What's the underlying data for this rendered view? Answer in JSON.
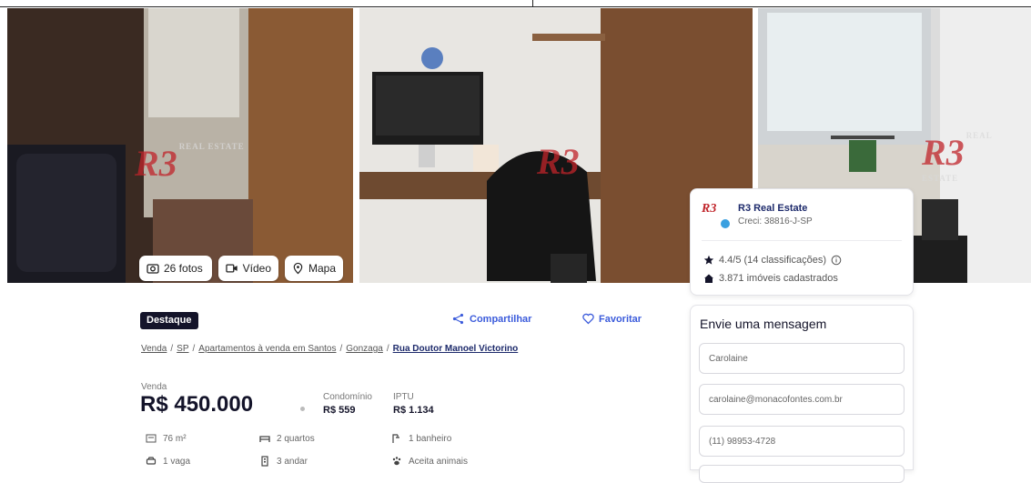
{
  "gallery": {
    "photos_label": "26 fotos",
    "video_label": "Vídeo",
    "map_label": "Mapa",
    "watermark": "R3",
    "watermark_sub": "REAL ESTATE"
  },
  "agent": {
    "name": "R3 Real Estate",
    "creci": "Creci: 38816-J-SP",
    "rating": "4.4/5 (14 classificações)",
    "listings": "3.871 imóveis cadastrados",
    "logo": "R3"
  },
  "listing": {
    "badge": "Destaque",
    "share_label": "Compartilhar",
    "favorite_label": "Favoritar",
    "breadcrumb": [
      "Venda",
      "SP",
      "Apartamentos à venda em Santos",
      "Gonzaga"
    ],
    "breadcrumb_current": "Rua Doutor Manoel Victorino",
    "sale_label": "Venda",
    "price": "R$ 450.000",
    "condo_label": "Condomínio",
    "condo_value": "R$ 559",
    "iptu_label": "IPTU",
    "iptu_value": "R$ 1.134",
    "features": {
      "area": "76 m²",
      "bedrooms": "2 quartos",
      "bathrooms": "1 banheiro",
      "parking": "1 vaga",
      "floor": "3 andar",
      "pets": "Aceita animais"
    }
  },
  "contact_form": {
    "title": "Envie uma mensagem",
    "name_value": "Carolaine",
    "email_value": "carolaine@monacofontes.com.br",
    "phone_value": "(11) 98953-4728"
  },
  "colors": {
    "brand_red": "#c0242a",
    "link_blue": "#3b5bdb",
    "navy": "#1d2a6b"
  }
}
